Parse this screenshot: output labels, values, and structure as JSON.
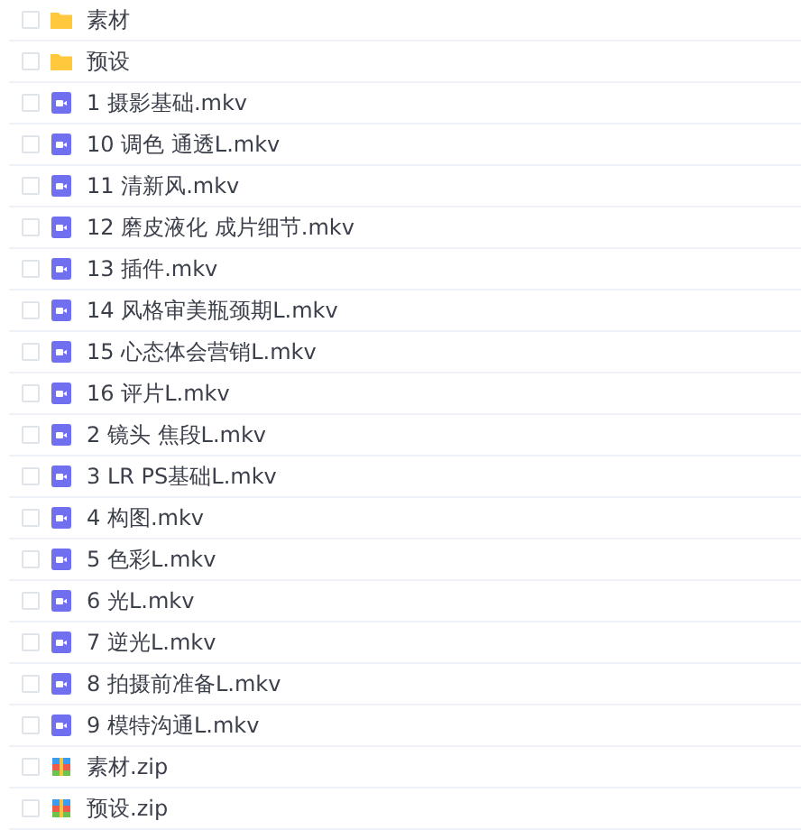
{
  "files": [
    {
      "kind": "folder",
      "name": "素材",
      "checked": false
    },
    {
      "kind": "folder",
      "name": "预设",
      "checked": false
    },
    {
      "kind": "video",
      "name": "1 摄影基础.mkv",
      "checked": false
    },
    {
      "kind": "video",
      "name": "10 调色 通透L.mkv",
      "checked": false
    },
    {
      "kind": "video",
      "name": "11 清新风.mkv",
      "checked": false
    },
    {
      "kind": "video",
      "name": "12 磨皮液化 成片细节.mkv",
      "checked": false
    },
    {
      "kind": "video",
      "name": "13 插件.mkv",
      "checked": false
    },
    {
      "kind": "video",
      "name": "14 风格审美瓶颈期L.mkv",
      "checked": false
    },
    {
      "kind": "video",
      "name": "15 心态体会营销L.mkv",
      "checked": false
    },
    {
      "kind": "video",
      "name": "16 评片L.mkv",
      "checked": false
    },
    {
      "kind": "video",
      "name": "2 镜头 焦段L.mkv",
      "checked": false
    },
    {
      "kind": "video",
      "name": "3 LR PS基础L.mkv",
      "checked": false
    },
    {
      "kind": "video",
      "name": "4 构图.mkv",
      "checked": false
    },
    {
      "kind": "video",
      "name": "5 色彩L.mkv",
      "checked": false
    },
    {
      "kind": "video",
      "name": "6 光L.mkv",
      "checked": false
    },
    {
      "kind": "video",
      "name": "7 逆光L.mkv",
      "checked": false
    },
    {
      "kind": "video",
      "name": "8 拍摄前准备L.mkv",
      "checked": false
    },
    {
      "kind": "video",
      "name": "9 模特沟通L.mkv",
      "checked": false
    },
    {
      "kind": "zip",
      "name": "素材.zip",
      "checked": false
    },
    {
      "kind": "zip",
      "name": "预设.zip",
      "checked": false
    }
  ]
}
